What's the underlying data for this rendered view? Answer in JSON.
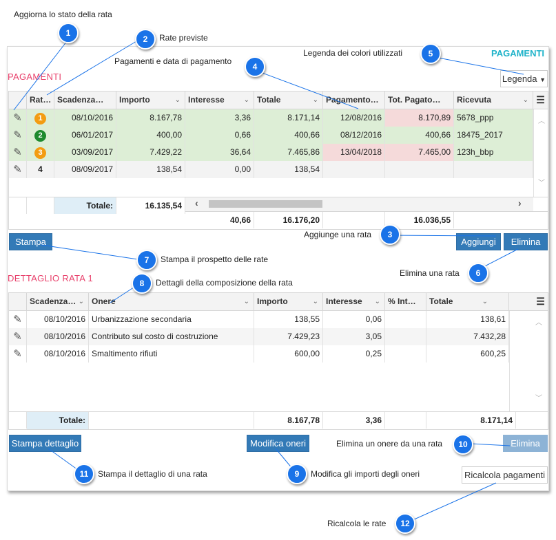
{
  "annotations": {
    "c1": {
      "num": "1",
      "text": "Aggiorna lo stato della rata"
    },
    "c2": {
      "num": "2",
      "text": "Rate previste"
    },
    "c3": {
      "num": "3",
      "text": "Aggiunge una rata"
    },
    "c4": {
      "num": "4",
      "text": "Pagamenti e data di pagamento"
    },
    "c5": {
      "num": "5",
      "text": "Legenda dei colori utilizzati"
    },
    "c6": {
      "num": "6",
      "text": "Elimina una rata"
    },
    "c7": {
      "num": "7",
      "text": "Stampa il prospetto delle rate"
    },
    "c8": {
      "num": "8",
      "text": "Dettagli della composizione della rata"
    },
    "c9": {
      "num": "9",
      "text": "Modifica gli importi degli oneri"
    },
    "c10": {
      "num": "10",
      "text": "Elimina un onere da una rata"
    },
    "c11": {
      "num": "11",
      "text": "Stampa il dettaglio di una rata"
    },
    "c12": {
      "num": "12",
      "text": "Ricalcola le rate"
    }
  },
  "pagamenti": {
    "title": "PAGAMENTI",
    "title_right": "PAGAMENTI",
    "legend_label": "Legenda",
    "columns": [
      "Rat…",
      "Scadenza…",
      "Importo",
      "Interesse",
      "Totale",
      "Pagamento…",
      "Tot. Pagato…",
      "Ricevuta"
    ],
    "rows": [
      {
        "num": "1",
        "badge": "#f39c12",
        "scadenza": "08/10/2016",
        "importo": "8.167,78",
        "interesse": "3,36",
        "totale": "8.171,14",
        "pagamento": "12/08/2016",
        "tot_pagato": "8.170,89",
        "ricevuta": "5678_ppp"
      },
      {
        "num": "2",
        "badge": "#1e8a2e",
        "scadenza": "06/01/2017",
        "importo": "400,00",
        "interesse": "0,66",
        "totale": "400,66",
        "pagamento": "08/12/2016",
        "tot_pagato": "400,66",
        "ricevuta": "18475_2017"
      },
      {
        "num": "3",
        "badge": "#f39c12",
        "scadenza": "03/09/2017",
        "importo": "7.429,22",
        "interesse": "36,64",
        "totale": "7.465,86",
        "pagamento": "13/04/2018",
        "tot_pagato": "7.465,00",
        "ricevuta": "123h_bbp"
      },
      {
        "num": "4",
        "badge": "",
        "scadenza": "08/09/2017",
        "importo": "138,54",
        "interesse": "0,00",
        "totale": "138,54",
        "pagamento": "",
        "tot_pagato": "",
        "ricevuta": ""
      }
    ],
    "totale_label": "Totale:",
    "totale_importo": "16.135,54",
    "totale_interesse": "40,66",
    "totale_totale": "16.176,20",
    "totale_pagato": "16.036,55"
  },
  "buttons": {
    "stampa": "Stampa",
    "aggiungi": "Aggiungi",
    "elimina": "Elimina",
    "stampa_dettaglio": "Stampa dettaglio",
    "modifica_oneri": "Modifica oneri",
    "elimina2": "Elimina",
    "ricalcola": "Ricalcola pagamenti"
  },
  "dettaglio": {
    "title": "DETTAGLIO RATA 1",
    "columns": [
      "Scadenza…",
      "Onere",
      "Importo",
      "Interesse",
      "% Int…",
      "Totale"
    ],
    "rows": [
      {
        "scadenza": "08/10/2016",
        "onere": "Urbanizzazione secondaria",
        "importo": "138,55",
        "interesse": "0,06",
        "perc": "",
        "totale": "138,61"
      },
      {
        "scadenza": "08/10/2016",
        "onere": "Contributo sul costo di costruzione",
        "importo": "7.429,23",
        "interesse": "3,05",
        "perc": "",
        "totale": "7.432,28"
      },
      {
        "scadenza": "08/10/2016",
        "onere": "Smaltimento rifiuti",
        "importo": "600,00",
        "interesse": "0,25",
        "perc": "",
        "totale": "600,25"
      }
    ],
    "totale_label": "Totale:",
    "totale_importo": "8.167,78",
    "totale_interesse": "3,36",
    "totale_totale": "8.171,14"
  }
}
